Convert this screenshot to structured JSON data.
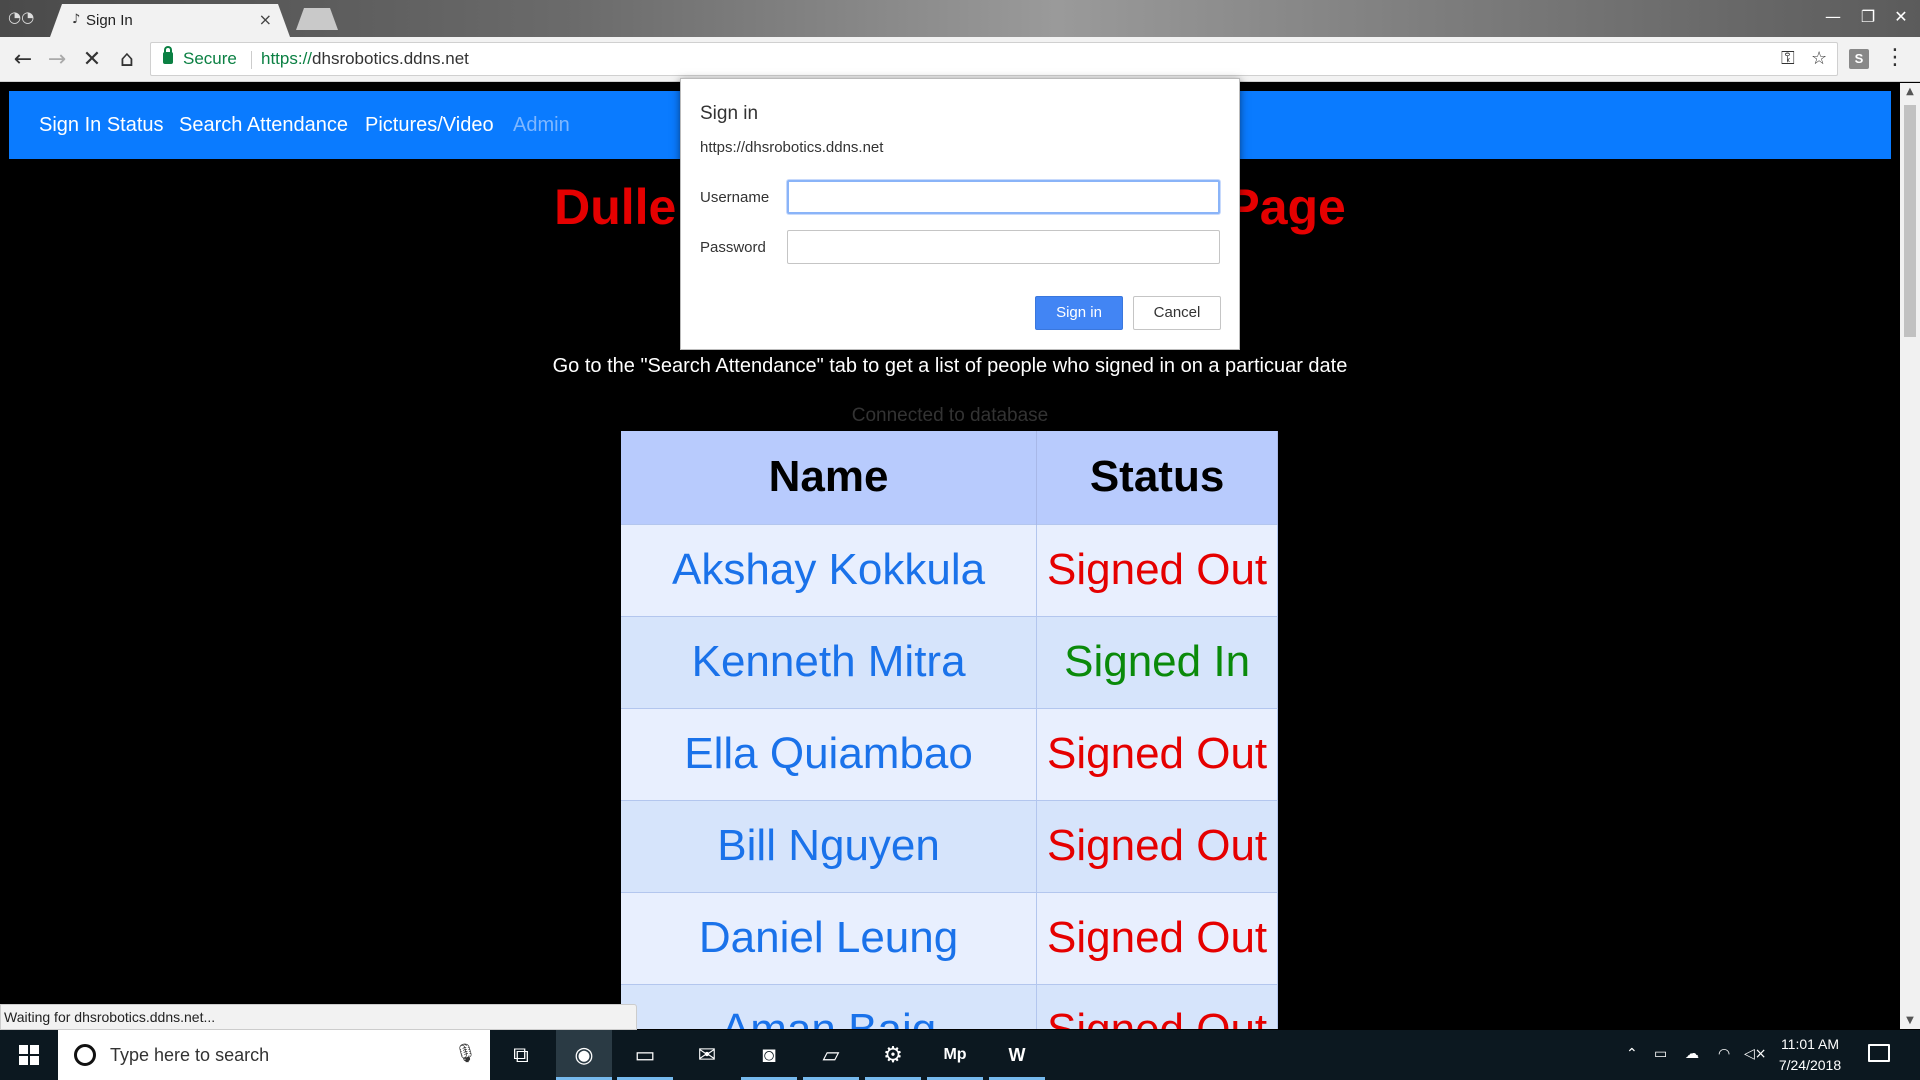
{
  "browser": {
    "tab_title": "Sign In",
    "tab_close": "×",
    "security_label": "Secure",
    "url_scheme": "https://",
    "url_host": "dhsrobotics.ddns.net",
    "extension_label": "S",
    "status_text": "Waiting for dhsrobotics.ddns.net...",
    "icons": [
      "incognito-icon",
      "back-icon",
      "forward-icon",
      "stop-icon",
      "home-icon",
      "lock-icon",
      "key-icon",
      "star-icon",
      "menu-icon"
    ]
  },
  "page": {
    "nav": [
      {
        "label": "Sign In Status"
      },
      {
        "label": "Search Attendance"
      },
      {
        "label": "Pictures/Video"
      },
      {
        "label": "Admin"
      }
    ],
    "title_left": "Dulle",
    "title_right": "Page",
    "instruction": "Go to the \"Search Attendance\" tab to get a list of people who signed in on a particuar date",
    "db_status": "Connected to database",
    "table": {
      "headers": [
        "Name",
        "Status"
      ],
      "rows": [
        {
          "name": "Akshay Kokkula",
          "status": "Signed Out"
        },
        {
          "name": "Kenneth Mitra",
          "status": "Signed In"
        },
        {
          "name": "Ella Quiambao",
          "status": "Signed Out"
        },
        {
          "name": "Bill Nguyen",
          "status": "Signed Out"
        },
        {
          "name": "Daniel Leung",
          "status": "Signed Out"
        },
        {
          "name": "Aman Baig",
          "status": "Signed Out"
        }
      ]
    },
    "colors": {
      "signed_in": "#0a8a0a",
      "signed_out": "#e50000",
      "navbar": "#0a7bff"
    }
  },
  "dialog": {
    "title": "Sign in",
    "origin": "https://dhsrobotics.ddns.net",
    "username_label": "Username",
    "username_value": "",
    "password_label": "Password",
    "password_value": "",
    "signin_label": "Sign in",
    "cancel_label": "Cancel"
  },
  "taskbar": {
    "search_placeholder": "Type here to search",
    "time": "11:01 AM",
    "date": "7/24/2018",
    "apps": [
      "chrome-icon",
      "file-explorer-icon",
      "mail-icon",
      "app-icon",
      "notepad-icon",
      "settings-icon",
      "mp-icon",
      "word-icon"
    ]
  }
}
